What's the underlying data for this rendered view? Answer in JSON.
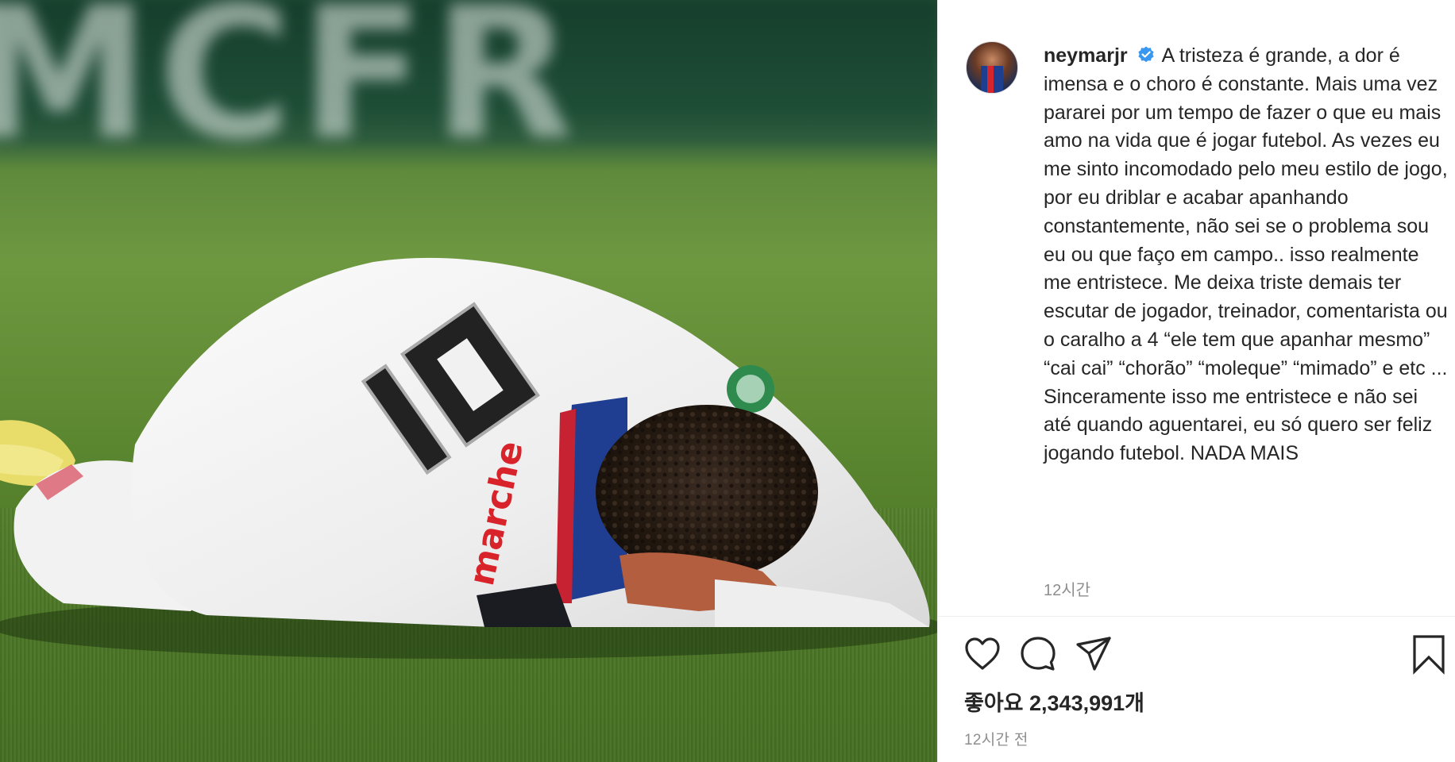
{
  "post": {
    "username": "neymarjr",
    "verified_icon": "verified-badge-icon",
    "caption_first": "A tristeza é grande, a dor é imensa e o choro é constante. Mais uma vez pararei por um tempo de fazer o que eu mais amo na vida que é jogar futebol. As vezes eu me sinto incomodado pelo meu estilo de jogo, por eu driblar e acabar apanhando constantemente, não sei se o problema sou eu ou que faço em campo.. isso realmente me entristece. Me deixa triste demais ter escutar de jogador, treinador, comentarista ou o caralho a 4 “ele tem que apanhar mesmo” “cai cai” “chorão” “moleque” “mimado” e etc ...",
    "caption_second": "Sinceramente isso me entristece e não sei até quando aguentarei, eu só quero ser feliz jogando futebol. NADA MAIS",
    "caption_time": "12시간",
    "likes": "좋아요 2,343,991개",
    "post_time": "12시간 전"
  },
  "photo": {
    "banner_text": "MCFR",
    "jersey_number": "10",
    "sponsor_text": "marche"
  },
  "actions": {
    "like": "heart-icon",
    "comment": "comment-bubble-icon",
    "share": "send-paper-plane-icon",
    "save": "bookmark-icon"
  },
  "colors": {
    "text": "#262626",
    "secondary": "#8e8e8e",
    "verified_blue": "#3897f0",
    "divider": "#efefef"
  }
}
